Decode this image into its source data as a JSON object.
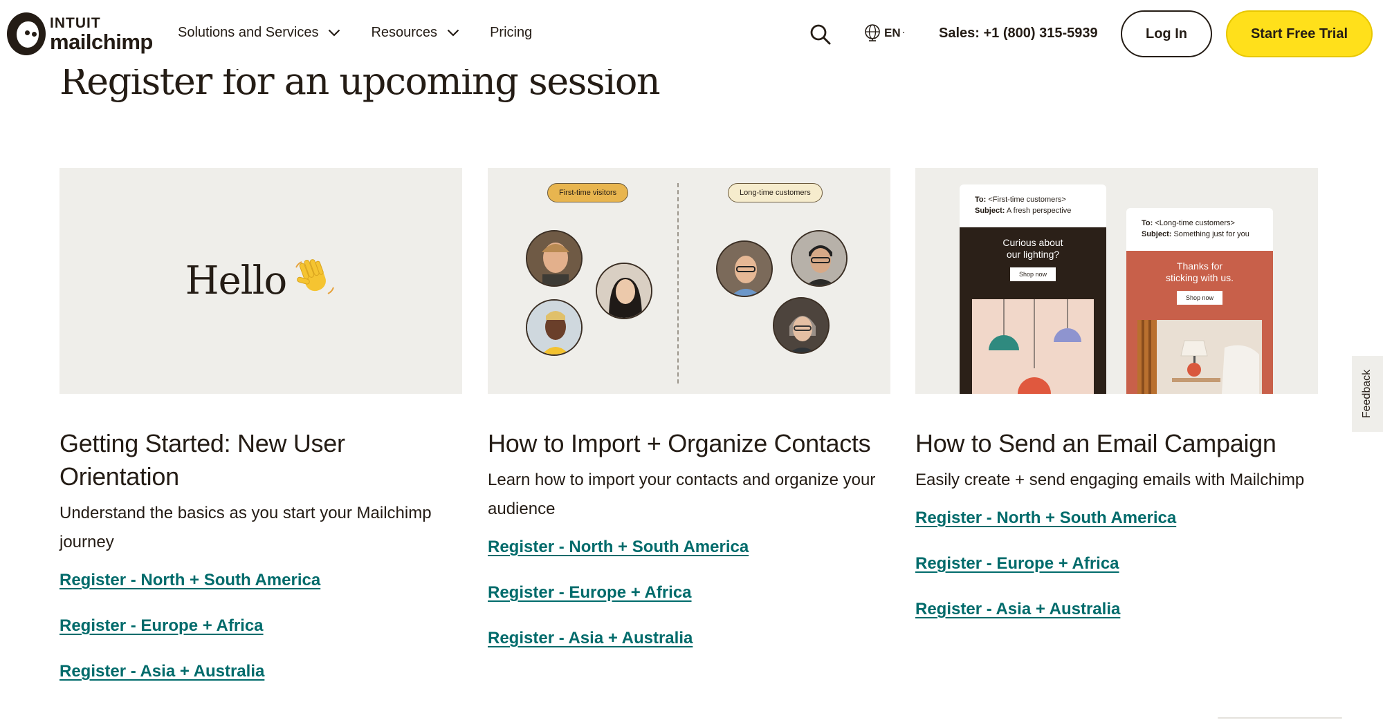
{
  "header": {
    "logo": {
      "intuit": "INTUIT",
      "brand": "mailchimp"
    },
    "nav": [
      {
        "label": "Solutions and Services",
        "has_dropdown": true
      },
      {
        "label": "Resources",
        "has_dropdown": true
      },
      {
        "label": "Pricing",
        "has_dropdown": false
      }
    ],
    "search_icon": "search-icon",
    "language": {
      "icon": "globe-icon",
      "code": "EN",
      "caret": "·"
    },
    "sales": "Sales: +1 (800) 315-5939",
    "login_label": "Log In",
    "trial_label": "Start Free Trial"
  },
  "section": {
    "title": "Register for an upcoming session"
  },
  "cards": [
    {
      "media": {
        "type": "hello",
        "text": "Hello",
        "emoji": "waving-hand-icon"
      },
      "title": "Getting Started: New User Orientation",
      "description": "Understand the basics as you start your Mailchimp journey",
      "links": [
        "Register - North + South America",
        "Register - Europe + Africa",
        "Register - Asia + Australia"
      ]
    },
    {
      "media": {
        "type": "audiences",
        "left_pill": "First-time visitors",
        "right_pill": "Long-time customers"
      },
      "title": "How to Import + Organize Contacts",
      "description": "Learn how to import your contacts and organize your audience",
      "links": [
        "Register - North + South America",
        "Register - Europe + Africa",
        "Register - Asia + Australia"
      ]
    },
    {
      "media": {
        "type": "emails",
        "email1": {
          "to_label": "To:",
          "to_value": " <First-time customers>",
          "subject_label": "Subject:",
          "subject_value": " A fresh perspective",
          "hero_line1": "Curious about",
          "hero_line2": "our lighting?",
          "button": "Shop now"
        },
        "email2": {
          "to_label": "To:",
          "to_value": " <Long-time customers>",
          "subject_label": "Subject:",
          "subject_value": " Something just for you",
          "hero_line1": "Thanks for",
          "hero_line2": "sticking with us.",
          "button": "Shop now"
        }
      },
      "title": "How to Send an Email Campaign",
      "description": "Easily create + send engaging emails with Mailchimp",
      "links": [
        "Register - North + South America",
        "Register - Europe + Africa",
        "Register - Asia + Australia"
      ]
    }
  ],
  "feedback_tab": "Feedback",
  "colors": {
    "brand_yellow": "#ffe01b",
    "link_teal": "#006b6b",
    "text_dark": "#241c15",
    "media_bg": "#efeeea",
    "email_dark": "#2b2018",
    "email_red": "#c8604a"
  }
}
